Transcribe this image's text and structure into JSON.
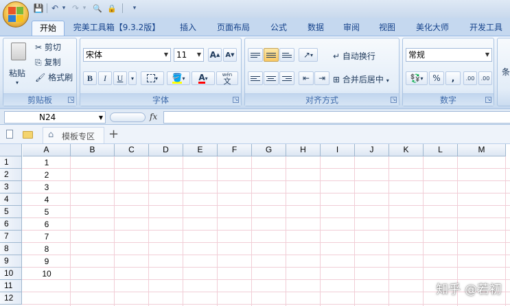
{
  "quick_access": {
    "save": "💾",
    "undo": "↶",
    "undo_dropdown": "▾",
    "redo": "↷",
    "redo_dropdown": "▾",
    "print_preview": "🔍",
    "lock": "🔒",
    "customize": "▾"
  },
  "tabs": [
    {
      "label": "开始",
      "active": true
    },
    {
      "label": "完美工具箱【9.3.2版】"
    },
    {
      "label": "插入"
    },
    {
      "label": "页面布局"
    },
    {
      "label": "公式"
    },
    {
      "label": "数据"
    },
    {
      "label": "审阅"
    },
    {
      "label": "视图"
    },
    {
      "label": "美化大师"
    },
    {
      "label": "开发工具"
    }
  ],
  "clipboard": {
    "paste": "粘贴",
    "cut": "剪切",
    "copy": "复制",
    "format_painter": "格式刷",
    "label": "剪贴板"
  },
  "font": {
    "name": "宋体",
    "size": "11",
    "grow": "A",
    "shrink": "A",
    "bold": "B",
    "italic": "I",
    "underline": "U",
    "font_color_letter": "A",
    "phonetic_top": "wén",
    "phonetic_char": "文",
    "label": "字体"
  },
  "alignment": {
    "wrap_text": "自动换行",
    "merge_center": "合并后居中",
    "label": "对齐方式"
  },
  "number": {
    "format": "常规",
    "percent": "%",
    "comma": ",",
    "inc_decimal": ".00",
    "dec_decimal": ".00",
    "label": "数字"
  },
  "styles_partial": "条",
  "name_box": "N24",
  "fx": "fx",
  "file_tab": {
    "label": "模板专区",
    "add": "+"
  },
  "columns": [
    "A",
    "B",
    "C",
    "D",
    "E",
    "F",
    "G",
    "H",
    "I",
    "J",
    "K",
    "L",
    "M"
  ],
  "rows": [
    "1",
    "2",
    "3",
    "4",
    "5",
    "6",
    "7",
    "8",
    "9",
    "10",
    "11",
    "12"
  ],
  "column_a_values": [
    "1",
    "2",
    "3",
    "4",
    "5",
    "6",
    "7",
    "8",
    "9",
    "10"
  ],
  "watermark": "知乎 @若初"
}
